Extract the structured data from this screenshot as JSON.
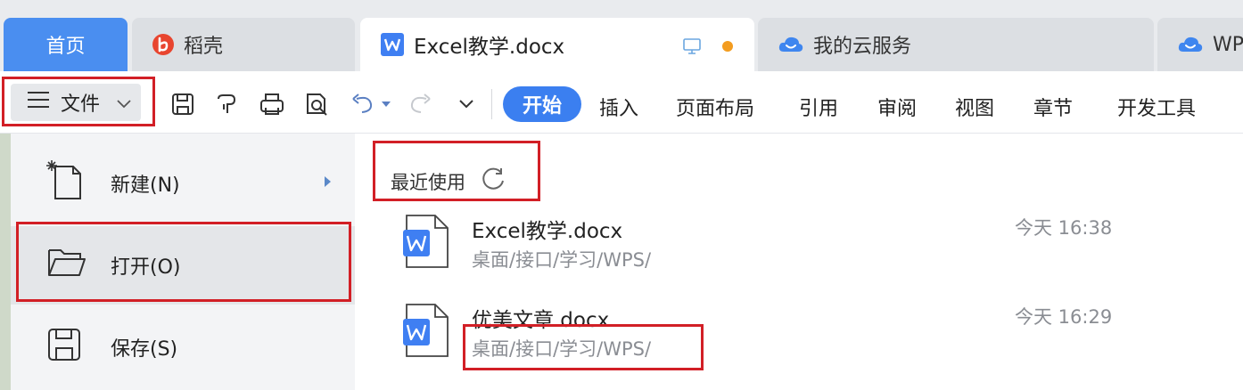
{
  "tabs": {
    "home": "首页",
    "daoke": "稻壳",
    "doc": "Excel教学.docx",
    "cloud": "我的云服务",
    "wps": "WP"
  },
  "toolbar": {
    "file_label": "文件",
    "menu": [
      "开始",
      "插入",
      "页面布局",
      "引用",
      "审阅",
      "视图",
      "章节",
      "开发工具"
    ]
  },
  "file_menu": {
    "new": "新建(N)",
    "open": "打开(O)",
    "save": "保存(S)"
  },
  "recent": {
    "heading": "最近使用",
    "files": [
      {
        "name": "Excel教学.docx",
        "path": "桌面/接口/学习/WPS/",
        "time": "今天 16:38"
      },
      {
        "name": "优美文章.docx",
        "path": "桌面/接口/学习/WPS/",
        "time": "今天 16:29"
      }
    ]
  },
  "colors": {
    "accent": "#3b7ff0",
    "highlight_box": "#d21f26",
    "unsaved_dot": "#f39c1f"
  }
}
